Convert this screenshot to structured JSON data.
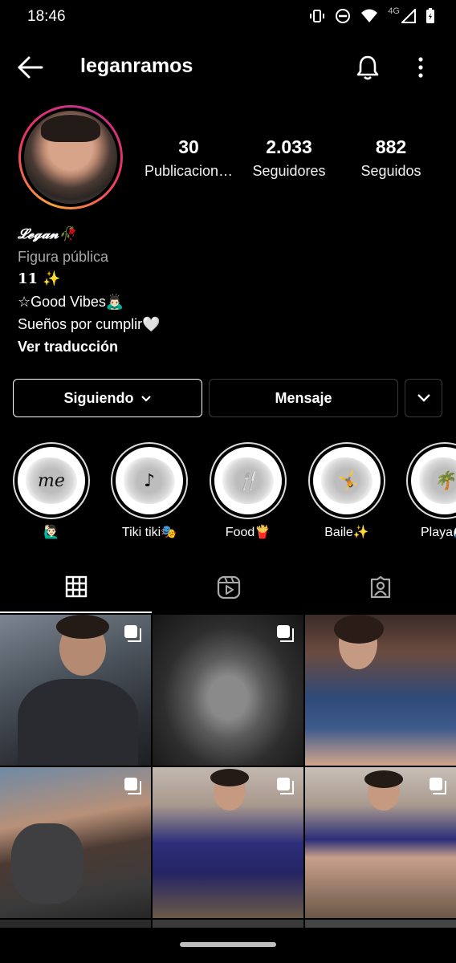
{
  "status_bar": {
    "time": "18:46",
    "network": "4G"
  },
  "header": {
    "username": "leganramos",
    "icons": [
      "back-arrow-icon",
      "bell-icon",
      "more-vertical-icon"
    ]
  },
  "profile": {
    "stats": [
      {
        "value": "30",
        "label": "Publicacion…"
      },
      {
        "value": "2.033",
        "label": "Seguidores"
      },
      {
        "value": "882",
        "label": "Seguidos"
      }
    ],
    "bio": {
      "name": "𝓛𝓮𝓰𝓪𝓷🥀",
      "category": "Figura pública",
      "line1": "11 ✨",
      "line2": "☆Good Vibes🙇🏻‍♂️",
      "line3": "Sueños por cumplir🤍",
      "translate": "Ver traducción"
    }
  },
  "actions": {
    "following": "Siguiendo",
    "message": "Mensaje"
  },
  "highlights": [
    {
      "cover_text": "me",
      "label": "🙋🏻‍♂️"
    },
    {
      "cover_text": "♪",
      "label": "Tiki tiki🎭"
    },
    {
      "cover_text": "🍴",
      "label": "Food🍟"
    },
    {
      "cover_text": "🤸",
      "label": "Baile✨"
    },
    {
      "cover_text": "🌴",
      "label": "Playa🌊"
    }
  ],
  "tabs": [
    "grid-icon",
    "reels-icon",
    "tagged-icon"
  ],
  "colors": {
    "background": "#000000",
    "text": "#ffffff",
    "secondary_text": "#a8a8a8",
    "story_ring_start": "#f9a33a",
    "story_ring_end": "#c1318f"
  }
}
